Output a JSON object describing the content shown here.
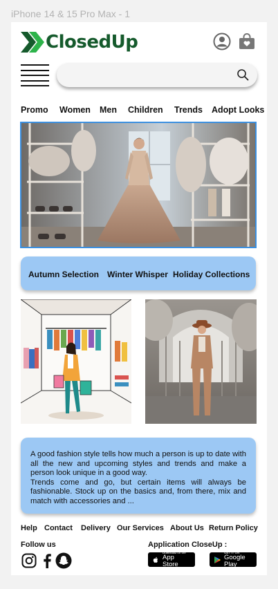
{
  "frame": {
    "label": "iPhone 14 & 15 Pro Max - 1"
  },
  "brand": {
    "name": "ClosedUp",
    "logo_color": "#155a2c",
    "accent_green": "#2db34a"
  },
  "header": {
    "icons": [
      "user-circle-icon",
      "shopping-bag-icon"
    ]
  },
  "search": {
    "placeholder": "",
    "value": ""
  },
  "nav": {
    "items": [
      {
        "label": "Promo"
      },
      {
        "label": "Women"
      },
      {
        "label": "Men"
      },
      {
        "label": "Children"
      },
      {
        "label": "Trends"
      },
      {
        "label": "Adopt Looks"
      }
    ]
  },
  "collections": {
    "color": "#9cc8f4",
    "items": [
      {
        "label": "Autumn Selection"
      },
      {
        "label": "Winter Whisper"
      },
      {
        "label": "Holiday Collections"
      }
    ]
  },
  "description": {
    "paragraph1": "A good fashion style tells how much a person is up to date with all the new and upcoming styles and trends and make a person look unique in a good way.",
    "paragraph2": "Trends come and go, but certain items will always be fashionable. Stock up on the basics and, from there, mix and match with accessories and ..."
  },
  "footer": {
    "links": [
      {
        "label": "Help"
      },
      {
        "label": "Contact"
      },
      {
        "label": "Delivery"
      },
      {
        "label": "Our Services"
      },
      {
        "label": "About Us"
      },
      {
        "label": "Return Policy"
      }
    ],
    "follow_label": "Follow us",
    "social": [
      "instagram-icon",
      "facebook-icon",
      "snapchat-icon"
    ],
    "app_label": "Application CloseUp :",
    "app_store": {
      "small": "Download on the",
      "big": "App Store"
    },
    "google_play": {
      "small": "GET IT ON",
      "big": "Google Play"
    }
  }
}
